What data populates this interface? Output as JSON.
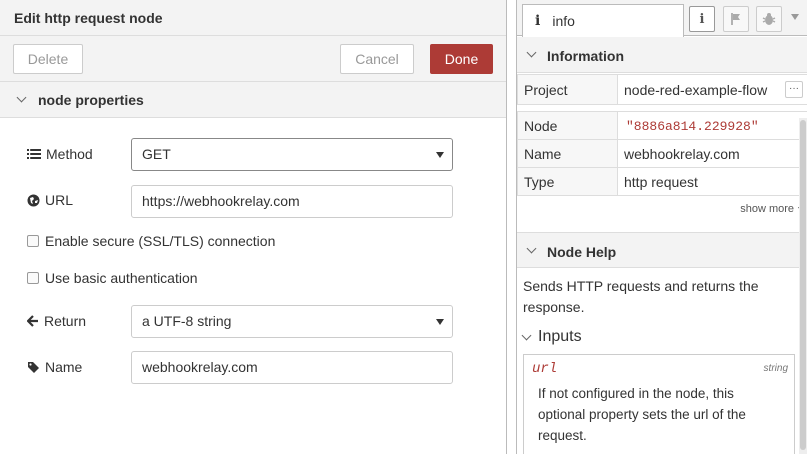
{
  "tray": {
    "title": "Edit http request node",
    "delete_label": "Delete",
    "cancel_label": "Cancel",
    "done_label": "Done",
    "section_title": "node properties",
    "method": {
      "label": "Method",
      "value": "GET"
    },
    "url": {
      "label": "URL",
      "value": "https://webhookrelay.com"
    },
    "ssl": {
      "label": "Enable secure (SSL/TLS) connection",
      "checked": false
    },
    "auth": {
      "label": "Use basic authentication",
      "checked": false
    },
    "return": {
      "label": "Return",
      "value": "a UTF-8 string"
    },
    "name": {
      "label": "Name",
      "value": "webhookrelay.com"
    }
  },
  "sidebar": {
    "tab_label": "info",
    "information_title": "Information",
    "project": {
      "key": "Project",
      "value": "node-red-example-flow",
      "more": "···"
    },
    "node": {
      "key": "Node",
      "value": "\"8886a814.229928\""
    },
    "name": {
      "key": "Name",
      "value": "webhookrelay.com"
    },
    "type": {
      "key": "Type",
      "value": "http request"
    },
    "show_more": "show more",
    "node_help_title": "Node Help",
    "help_text": "Sends HTTP requests and returns the response.",
    "inputs_title": "Inputs",
    "input_url": {
      "name": "url",
      "type": "string",
      "desc": "If not configured in the node, this optional property sets the url of the request."
    }
  },
  "colors": {
    "primary": "#ad3b36",
    "header_bg": "#f3f3f3",
    "border": "#cccccc"
  }
}
